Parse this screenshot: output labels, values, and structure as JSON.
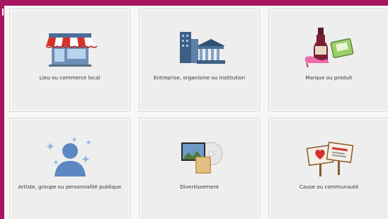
{
  "categories": [
    {
      "label": "Lieu ou commerce local",
      "icon": "storefront-icon"
    },
    {
      "label": "Entreprise, organisme ou institution",
      "icon": "buildings-icon"
    },
    {
      "label": "Marque ou produit",
      "icon": "products-icon"
    },
    {
      "label": "Artiste, groupe ou personnalité publique",
      "icon": "person-silhouette-icon"
    },
    {
      "label": "Divertissement",
      "icon": "entertainment-icon"
    },
    {
      "label": "Cause ou communauté",
      "icon": "cause-signs-icon"
    }
  ],
  "colors": {
    "frame": "#a8145f",
    "tile_bg": "#eeeeee",
    "tile_border": "#d9d9d9"
  }
}
